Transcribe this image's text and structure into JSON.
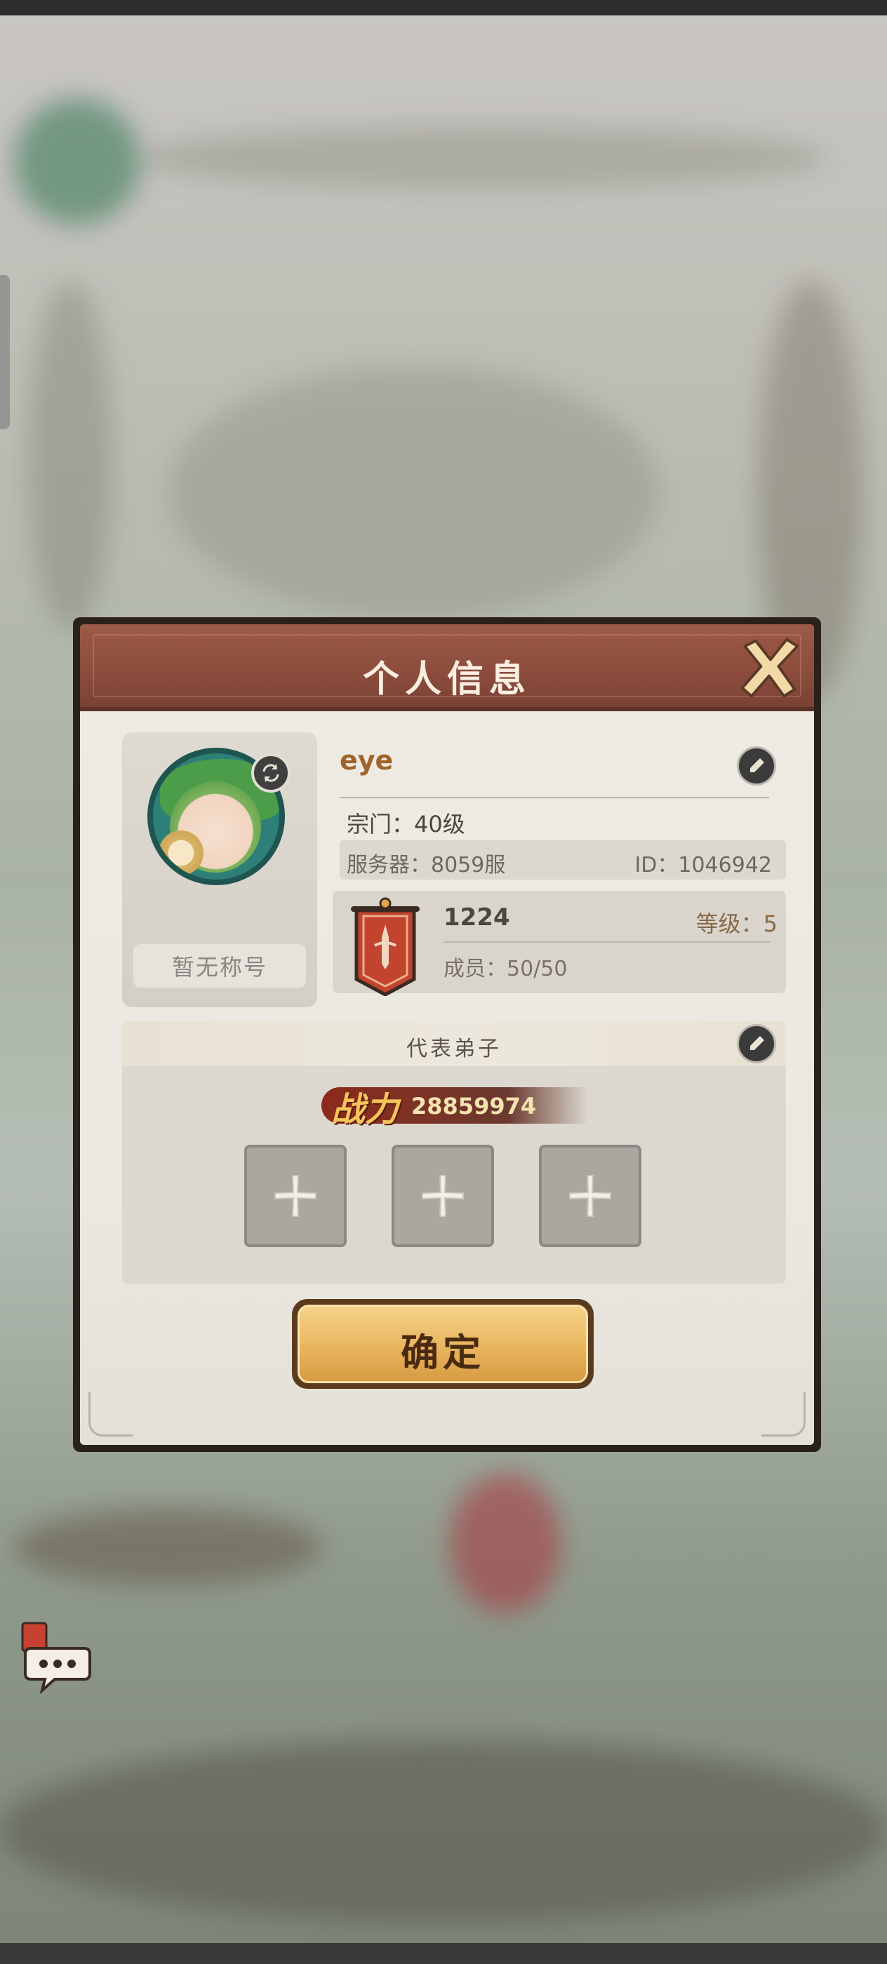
{
  "dialog": {
    "title": "个人信息",
    "close_icon": "close-x-icon"
  },
  "profile": {
    "name": "eye",
    "no_title": "暂无称号",
    "sect_level": "宗门：40级",
    "server_label": "服务器：8059服",
    "id_label": "ID：1046942"
  },
  "guild": {
    "name": "1224",
    "level": "等级：5",
    "members": "成员：50/50"
  },
  "disciples": {
    "title": "代表弟子",
    "power_label": "战力",
    "power_value": "28859974",
    "slots": [
      "empty",
      "empty",
      "empty"
    ]
  },
  "actions": {
    "confirm": "确定"
  },
  "colors": {
    "title_band": "#8b4c3c",
    "panel": "#ebe8e1",
    "name": "#a0642a",
    "confirm": "#e8b55d"
  }
}
